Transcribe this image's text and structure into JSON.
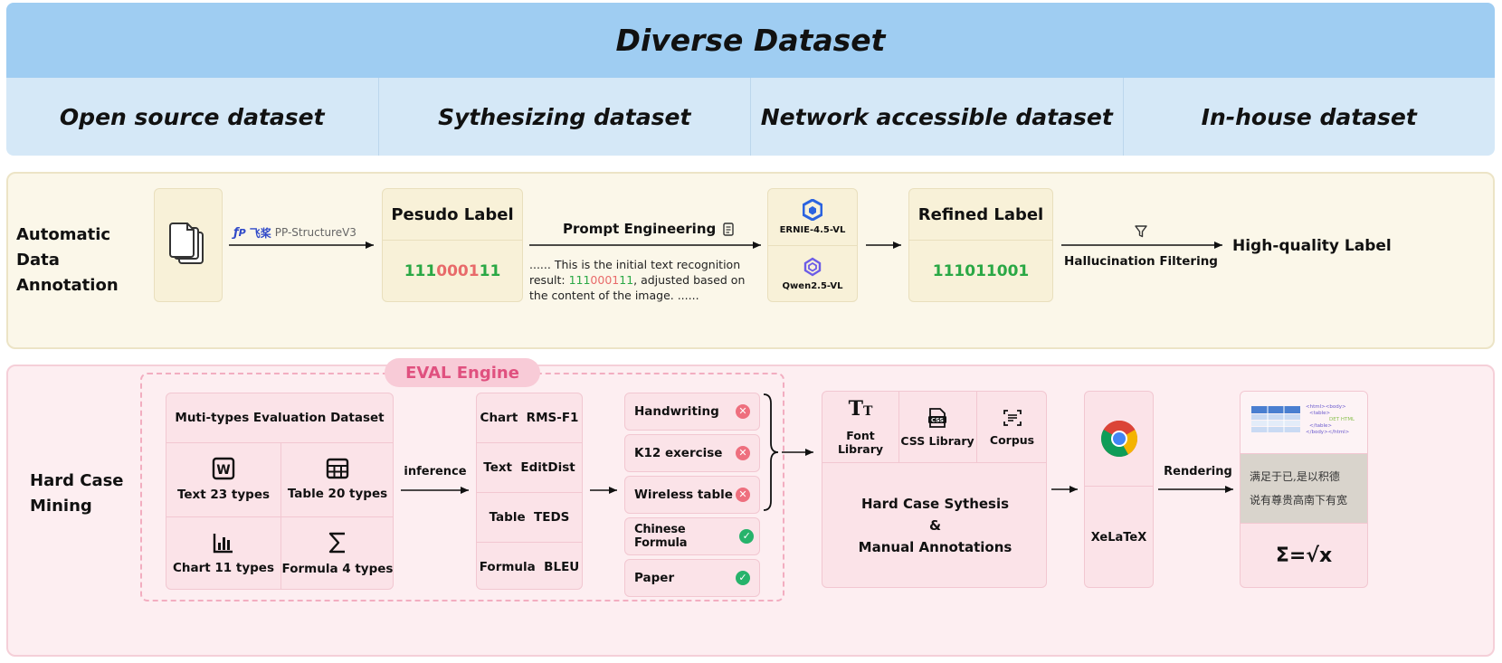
{
  "header": {
    "title": "Diverse Dataset",
    "sources": [
      "Open source dataset",
      "Sythesizing dataset",
      "Network accessible dataset",
      "In-house dataset"
    ]
  },
  "annotation": {
    "section_label": [
      "Automatic Data",
      "Annotation"
    ],
    "tool_brand": "飞桨",
    "tool_name": "PP-StructureV3",
    "pseudo_title": "Pesudo Label",
    "pseudo_digits": [
      {
        "d": "1",
        "ok": true
      },
      {
        "d": "1",
        "ok": true
      },
      {
        "d": "1",
        "ok": true
      },
      {
        "d": "0",
        "ok": false
      },
      {
        "d": "0",
        "ok": false
      },
      {
        "d": "0",
        "ok": false
      },
      {
        "d": "1",
        "ok": false
      },
      {
        "d": "1",
        "ok": true
      },
      {
        "d": "1",
        "ok": true
      }
    ],
    "prompt_title": "Prompt Engineering",
    "prompt_text_a": "...... This is the initial text recognition",
    "prompt_text_b": "result: ",
    "prompt_text_c": ", adjusted based on",
    "prompt_text_d": "the content of the image. ......",
    "model_a": "ERNIE-4.5-VL",
    "model_b": "Qwen2.5-VL",
    "refined_title": "Refined Label",
    "refined_value": "111011001",
    "filter_label": "Hallucination Filtering",
    "output_label": "High-quality Label"
  },
  "mining": {
    "section_label": [
      "Hard Case",
      "Mining"
    ],
    "engine_label": "EVAL Engine",
    "dataset_title": "Muti-types Evaluation Dataset",
    "types": [
      {
        "icon": "word-doc-icon",
        "label": "Text 23 types"
      },
      {
        "icon": "table-icon",
        "label": "Table 20 types"
      },
      {
        "icon": "bar-chart-icon",
        "label": "Chart 11 types"
      },
      {
        "icon": "sigma-icon",
        "label": "Formula 4 types"
      }
    ],
    "inference_label": "inference",
    "metrics": [
      "Chart  RMS-F1",
      "Text  EditDist",
      "Table  TEDS",
      "Formula  BLEU"
    ],
    "results": [
      {
        "label": "Handwriting",
        "pass": false
      },
      {
        "label": "K12 exercise",
        "pass": false
      },
      {
        "label": "Wireless table",
        "pass": false
      },
      {
        "label": "Chinese Formula",
        "pass": true
      },
      {
        "label": "Paper",
        "pass": true
      }
    ],
    "synthesis_sources": [
      "Font Library",
      "CSS Library",
      "Corpus"
    ],
    "synthesis_title": "Hard Case Sythesis",
    "synthesis_amp": "&",
    "synthesis_sub": "Manual Annotations",
    "renderer_label": "XeLaTeX",
    "rendering_label": "Rendering",
    "html_snippet": [
      "<html><body>",
      "<table>",
      "</table>",
      "</body></html>"
    ],
    "html_tag": "DET HTML",
    "sample_text_a": "满足于已,是以积德",
    "sample_text_b": "说有尊贵高南下有宽",
    "formula_text": "Σ=√x"
  }
}
